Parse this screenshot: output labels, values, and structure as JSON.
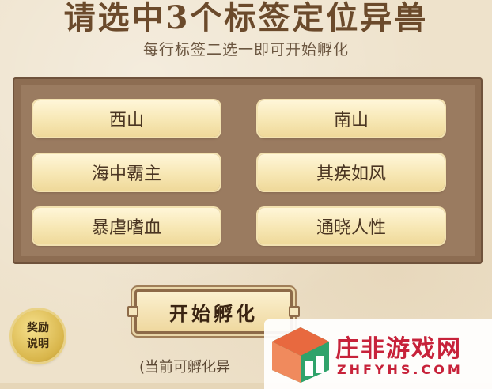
{
  "header": {
    "title": "请选中3个标签定位异兽",
    "subtitle": "每行标签二选一即可开始孵化"
  },
  "tags": [
    {
      "label": "西山"
    },
    {
      "label": "南山"
    },
    {
      "label": "海中霸主"
    },
    {
      "label": "其疾如风"
    },
    {
      "label": "暴虐嗜血"
    },
    {
      "label": "通晓人性"
    }
  ],
  "actions": {
    "hatch_label": "开始孵化"
  },
  "reward": {
    "line1": "奖励",
    "line2": "说明"
  },
  "note": "(当前可孵化异",
  "watermark": {
    "name": "庄非游戏网",
    "domain": "ZHFYHS.COM"
  },
  "colors": {
    "title": "#6b4a2b",
    "panel": "#9a7b60",
    "tag_fill": "#f7e7b4",
    "badge": "#d8b54a",
    "watermark_red": "#c7223a"
  }
}
